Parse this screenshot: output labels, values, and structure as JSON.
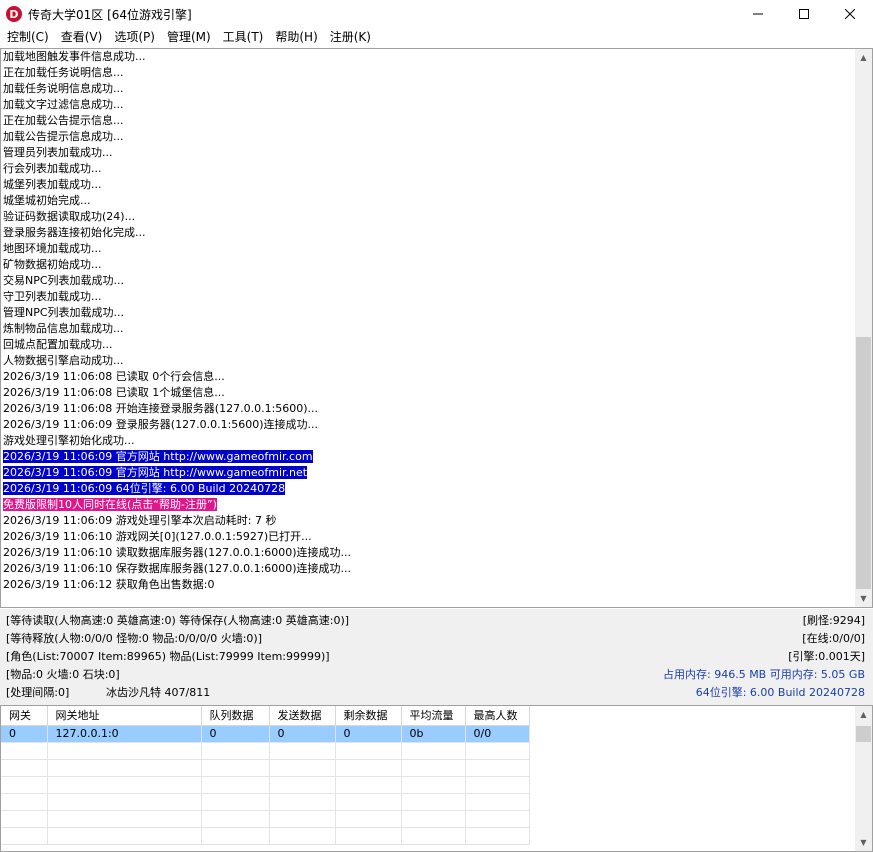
{
  "window": {
    "icon_letter": "D",
    "title": "传奇大学01区 [64位游戏引擎]"
  },
  "menu": [
    "控制(C)",
    "查看(V)",
    "选项(P)",
    "管理(M)",
    "工具(T)",
    "帮助(H)",
    "注册(K)"
  ],
  "log": [
    {
      "text": "加载地图触发事件信息成功..."
    },
    {
      "text": "正在加载任务说明信息..."
    },
    {
      "text": "加载任务说明信息成功..."
    },
    {
      "text": "加载文字过滤信息成功..."
    },
    {
      "text": "正在加载公告提示信息..."
    },
    {
      "text": "加载公告提示信息成功..."
    },
    {
      "text": "管理员列表加载成功..."
    },
    {
      "text": "行会列表加载成功..."
    },
    {
      "text": "城堡列表加载成功..."
    },
    {
      "text": "城堡城初始完成..."
    },
    {
      "text": "验证码数据读取成功(24)..."
    },
    {
      "text": "登录服务器连接初始化完成..."
    },
    {
      "text": "地图环境加载成功..."
    },
    {
      "text": "矿物数据初始成功..."
    },
    {
      "text": "交易NPC列表加载成功..."
    },
    {
      "text": "守卫列表加载成功..."
    },
    {
      "text": "管理NPC列表加载成功..."
    },
    {
      "text": "炼制物品信息加载成功..."
    },
    {
      "text": "回城点配置加载成功..."
    },
    {
      "text": "人物数据引擎启动成功..."
    },
    {
      "text": "2026/3/19 11:06:08 已读取 0个行会信息..."
    },
    {
      "text": "2026/3/19 11:06:08 已读取 1个城堡信息..."
    },
    {
      "text": "2026/3/19 11:06:08 开始连接登录服务器(127.0.0.1:5600)..."
    },
    {
      "text": "2026/3/19 11:06:09 登录服务器(127.0.0.1:5600)连接成功..."
    },
    {
      "text": "游戏处理引擎初始化成功..."
    },
    {
      "text": "2026/3/19 11:06:09 官方网站 http://www.gameofmir.com",
      "hl": "blue"
    },
    {
      "text": "2026/3/19 11:06:09 官方网站 http://www.gameofmir.net",
      "hl": "blue"
    },
    {
      "text": "2026/3/19 11:06:09 64位引擎: 6.00 Build 20240728",
      "hl": "blue"
    },
    {
      "text": "免费版限制10人同时在线(点击“帮助-注册”)",
      "hl": "pink"
    },
    {
      "text": "2026/3/19 11:06:09 游戏处理引擎本次启动耗时: 7 秒"
    },
    {
      "text": "2026/3/19 11:06:10 游戏网关[0](127.0.0.1:5927)已打开..."
    },
    {
      "text": "2026/3/19 11:06:10 读取数据库服务器(127.0.0.1:6000)连接成功..."
    },
    {
      "text": "2026/3/19 11:06:10 保存数据库服务器(127.0.0.1:6000)连接成功..."
    },
    {
      "text": "2026/3/19 11:06:12 获取角色出售数据:0"
    }
  ],
  "status": {
    "row1_left": "[等待读取(人物高速:0 英雄高速:0) 等待保存(人物高速:0 英雄高速:0)]",
    "row1_right": "[刷怪:9294]",
    "row2_left": "[等待释放(人物:0/0/0 怪物:0 物品:0/0/0/0 火墙:0)]",
    "row2_right": "[在线:0/0/0]",
    "row3_left": "[角色(List:70007 Item:89965) 物品(List:79999 Item:99999)]",
    "row3_right": "[引擎:0.001天]",
    "row4_left": "[物品:0 火墙:0 石块:0]",
    "row4_right": "占用内存: 946.5 MB 可用内存: 5.05 GB",
    "row5_left": "[处理间隔:0]",
    "row5_mid": "冰齿沙凡特 407/811",
    "row5_right": "64位引擎: 6.00 Build 20240728",
    "blue_color": "#1a3fa8"
  },
  "gateway_table": {
    "columns": [
      "网关",
      "网关地址",
      "队列数据",
      "发送数据",
      "剩余数据",
      "平均流量",
      "最高人数"
    ],
    "rows": [
      [
        "0",
        "127.0.0.1:0",
        "0",
        "0",
        "0",
        "0b",
        "0/0"
      ]
    ]
  }
}
